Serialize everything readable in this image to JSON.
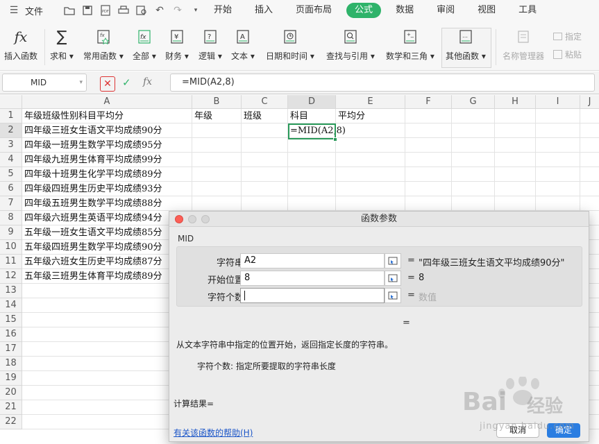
{
  "menubar": {
    "file": "文件",
    "tabs": [
      "开始",
      "插入",
      "页面布局",
      "公式",
      "数据",
      "审阅",
      "视图",
      "工具"
    ],
    "active_tab": "公式",
    "accent": "#2fb36a"
  },
  "ribbon": {
    "insert_function": "插入函数",
    "sum": "求和",
    "common": "常用函数",
    "all": "全部",
    "finance": "财务",
    "logic": "逻辑",
    "text": "文本",
    "datetime": "日期和时间",
    "lookup": "查找与引用",
    "math": "数学和三角",
    "other": "其他函数",
    "name_manager": "名称管理器",
    "assign": "指定",
    "paste": "粘贴"
  },
  "formula_bar": {
    "name_box": "MID",
    "fx": "fx",
    "formula": "=MID(A2,8)"
  },
  "sheet": {
    "columns": [
      "A",
      "B",
      "C",
      "D",
      "E",
      "F",
      "G",
      "H",
      "I",
      "J"
    ],
    "rows": [
      "1",
      "2",
      "3",
      "4",
      "5",
      "6",
      "7",
      "8",
      "9",
      "10",
      "11",
      "12",
      "13",
      "14",
      "15",
      "16",
      "17",
      "18",
      "19",
      "20",
      "21",
      "22"
    ],
    "header_row": {
      "A": "年级班级性别科目平均分",
      "B": "年级",
      "C": "班级",
      "D": "科目",
      "E": "平均分"
    },
    "col_a": [
      "四年级三班女生语文平均成绩90分",
      "四年级一班男生数学平均成绩95分",
      "四年级九班男生体育平均成绩99分",
      "四年级十班男生化学平均成绩89分",
      "四年级四班男生历史平均成绩93分",
      "四年级五班男生数学平均成绩88分",
      "四年级六班男生英语平均成绩94分",
      "五年级一班女生语文平均成绩85分",
      "五年级四班男生数学平均成绩90分",
      "五年级六班女生历史平均成绩87分",
      "五年级三班男生体育平均成绩89分"
    ],
    "d2": "=MID(A2,8)"
  },
  "dialog": {
    "title": "函数参数",
    "function_name": "MID",
    "args": [
      {
        "label": "字符串",
        "value": "A2",
        "result": "\"四年级三班女生语文平均成绩90分\""
      },
      {
        "label": "开始位置",
        "value": "8",
        "result": "8"
      },
      {
        "label": "字符个数",
        "value": "",
        "result": "数值"
      }
    ],
    "eq": "=",
    "description": "从文本字符串中指定的位置开始，返回指定长度的字符串。",
    "arg_desc": "字符个数: 指定所要提取的字符串长度",
    "calc_result": "计算结果=",
    "help": "有关该函数的帮助(H)",
    "cancel": "取消",
    "ok": "确定"
  },
  "watermark": {
    "brand": "Bai",
    "cn": "经验",
    "url": "jingyan.baidu.com"
  }
}
